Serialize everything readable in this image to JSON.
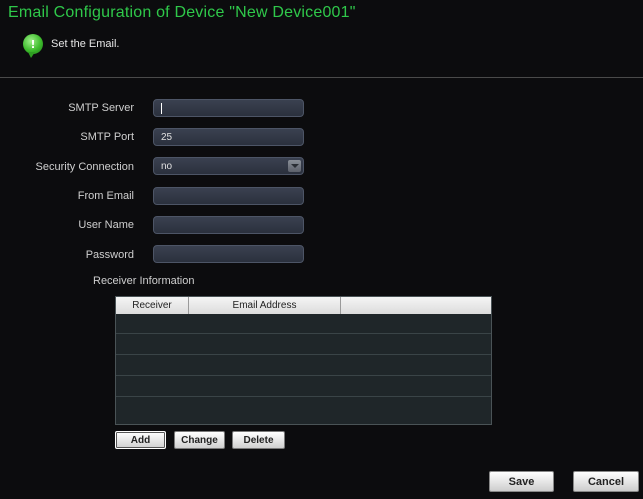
{
  "window": {
    "title": "Email Configuration of Device \"New Device001\""
  },
  "hint": {
    "icon": "info-bubble-icon",
    "text": "Set the Email."
  },
  "form": {
    "smtp_server": {
      "label": "SMTP Server",
      "value": ""
    },
    "smtp_port": {
      "label": "SMTP Port",
      "value": "25"
    },
    "security_connection": {
      "label": "Security Connection",
      "value": "no"
    },
    "from_email": {
      "label": "From Email",
      "value": ""
    },
    "user_name": {
      "label": "User Name",
      "value": ""
    },
    "password": {
      "label": "Password",
      "value": ""
    }
  },
  "receivers": {
    "section_label": "Receiver Information",
    "columns": [
      "Receiver",
      "Email Address",
      ""
    ],
    "rows": []
  },
  "buttons": {
    "add": "Add",
    "change": "Change",
    "delete": "Delete",
    "save": "Save",
    "cancel": "Cancel"
  },
  "colors": {
    "title": "#2fc84a",
    "background": "#0c0c0e",
    "field": "#333a47"
  }
}
